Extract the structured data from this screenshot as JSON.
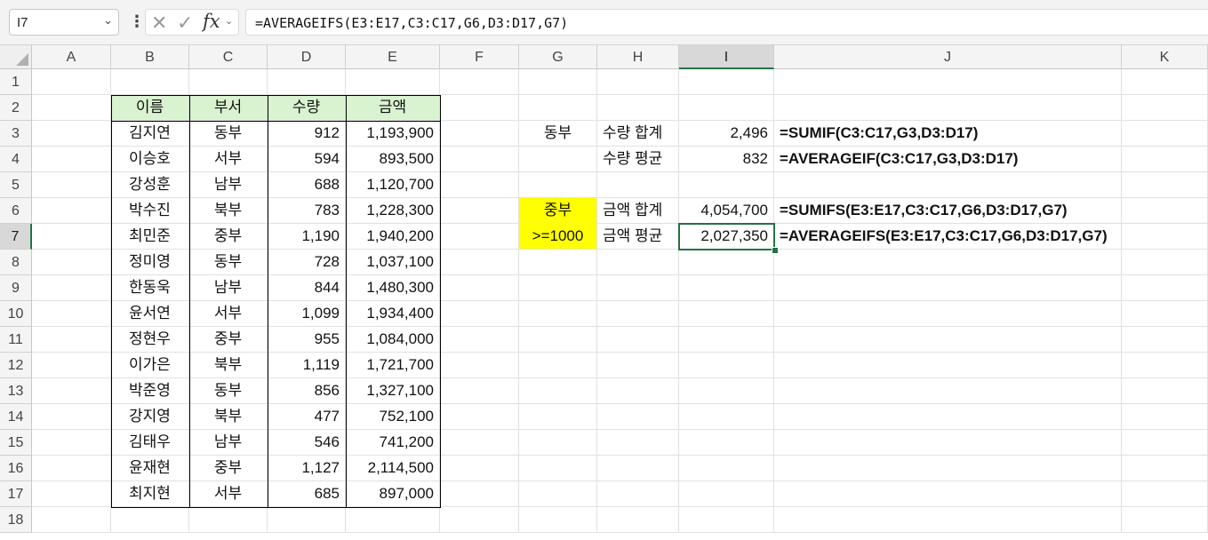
{
  "name_box": {
    "value": "I7",
    "chevron": "chevron-down-icon"
  },
  "formula_bar": {
    "more_icon": "⋮",
    "cancel_icon": "✕",
    "enter_icon": "✓",
    "fx_label": "fx",
    "formula": "=AVERAGEIFS(E3:E17,C3:C17,G6,D3:D17,G7)"
  },
  "colors": {
    "header_fill": "#d9f2d0",
    "highlight_fill": "#ffff00",
    "selection": "#217346"
  },
  "columns": [
    "A",
    "B",
    "C",
    "D",
    "E",
    "F",
    "G",
    "H",
    "I",
    "J",
    "K"
  ],
  "rows": [
    "1",
    "2",
    "3",
    "4",
    "5",
    "6",
    "7",
    "8",
    "9",
    "10",
    "11",
    "12",
    "13",
    "14",
    "15",
    "16",
    "17",
    "18"
  ],
  "selected_cell": "I7",
  "table": {
    "headers": [
      "이름",
      "부서",
      "수량",
      "금액"
    ],
    "rows": [
      [
        "김지연",
        "동부",
        "912",
        "1,193,900"
      ],
      [
        "이승호",
        "서부",
        "594",
        "893,500"
      ],
      [
        "강성훈",
        "남부",
        "688",
        "1,120,700"
      ],
      [
        "박수진",
        "북부",
        "783",
        "1,228,300"
      ],
      [
        "최민준",
        "중부",
        "1,190",
        "1,940,200"
      ],
      [
        "정미영",
        "동부",
        "728",
        "1,037,100"
      ],
      [
        "한동욱",
        "남부",
        "844",
        "1,480,300"
      ],
      [
        "윤서연",
        "서부",
        "1,099",
        "1,934,400"
      ],
      [
        "정현우",
        "중부",
        "955",
        "1,084,000"
      ],
      [
        "이가은",
        "북부",
        "1,119",
        "1,721,700"
      ],
      [
        "박준영",
        "동부",
        "856",
        "1,327,100"
      ],
      [
        "강지영",
        "북부",
        "477",
        "752,100"
      ],
      [
        "김태우",
        "남부",
        "546",
        "741,200"
      ],
      [
        "윤재현",
        "중부",
        "1,127",
        "2,114,500"
      ],
      [
        "최지현",
        "서부",
        "685",
        "897,000"
      ]
    ]
  },
  "summary": {
    "g3": "동부",
    "h3": "수량 합계",
    "i3": "2,496",
    "j3": "=SUMIF(C3:C17,G3,D3:D17)",
    "h4": "수량 평균",
    "i4": "832",
    "j4": "=AVERAGEIF(C3:C17,G3,D3:D17)",
    "g6": "중부",
    "h6": "금액 합계",
    "i6": "4,054,700",
    "j6": "=SUMIFS(E3:E17,C3:C17,G6,D3:D17,G7)",
    "g7": ">=1000",
    "h7": "금액 평균",
    "i7": "2,027,350",
    "j7": "=AVERAGEIFS(E3:E17,C3:C17,G6,D3:D17,G7)"
  }
}
